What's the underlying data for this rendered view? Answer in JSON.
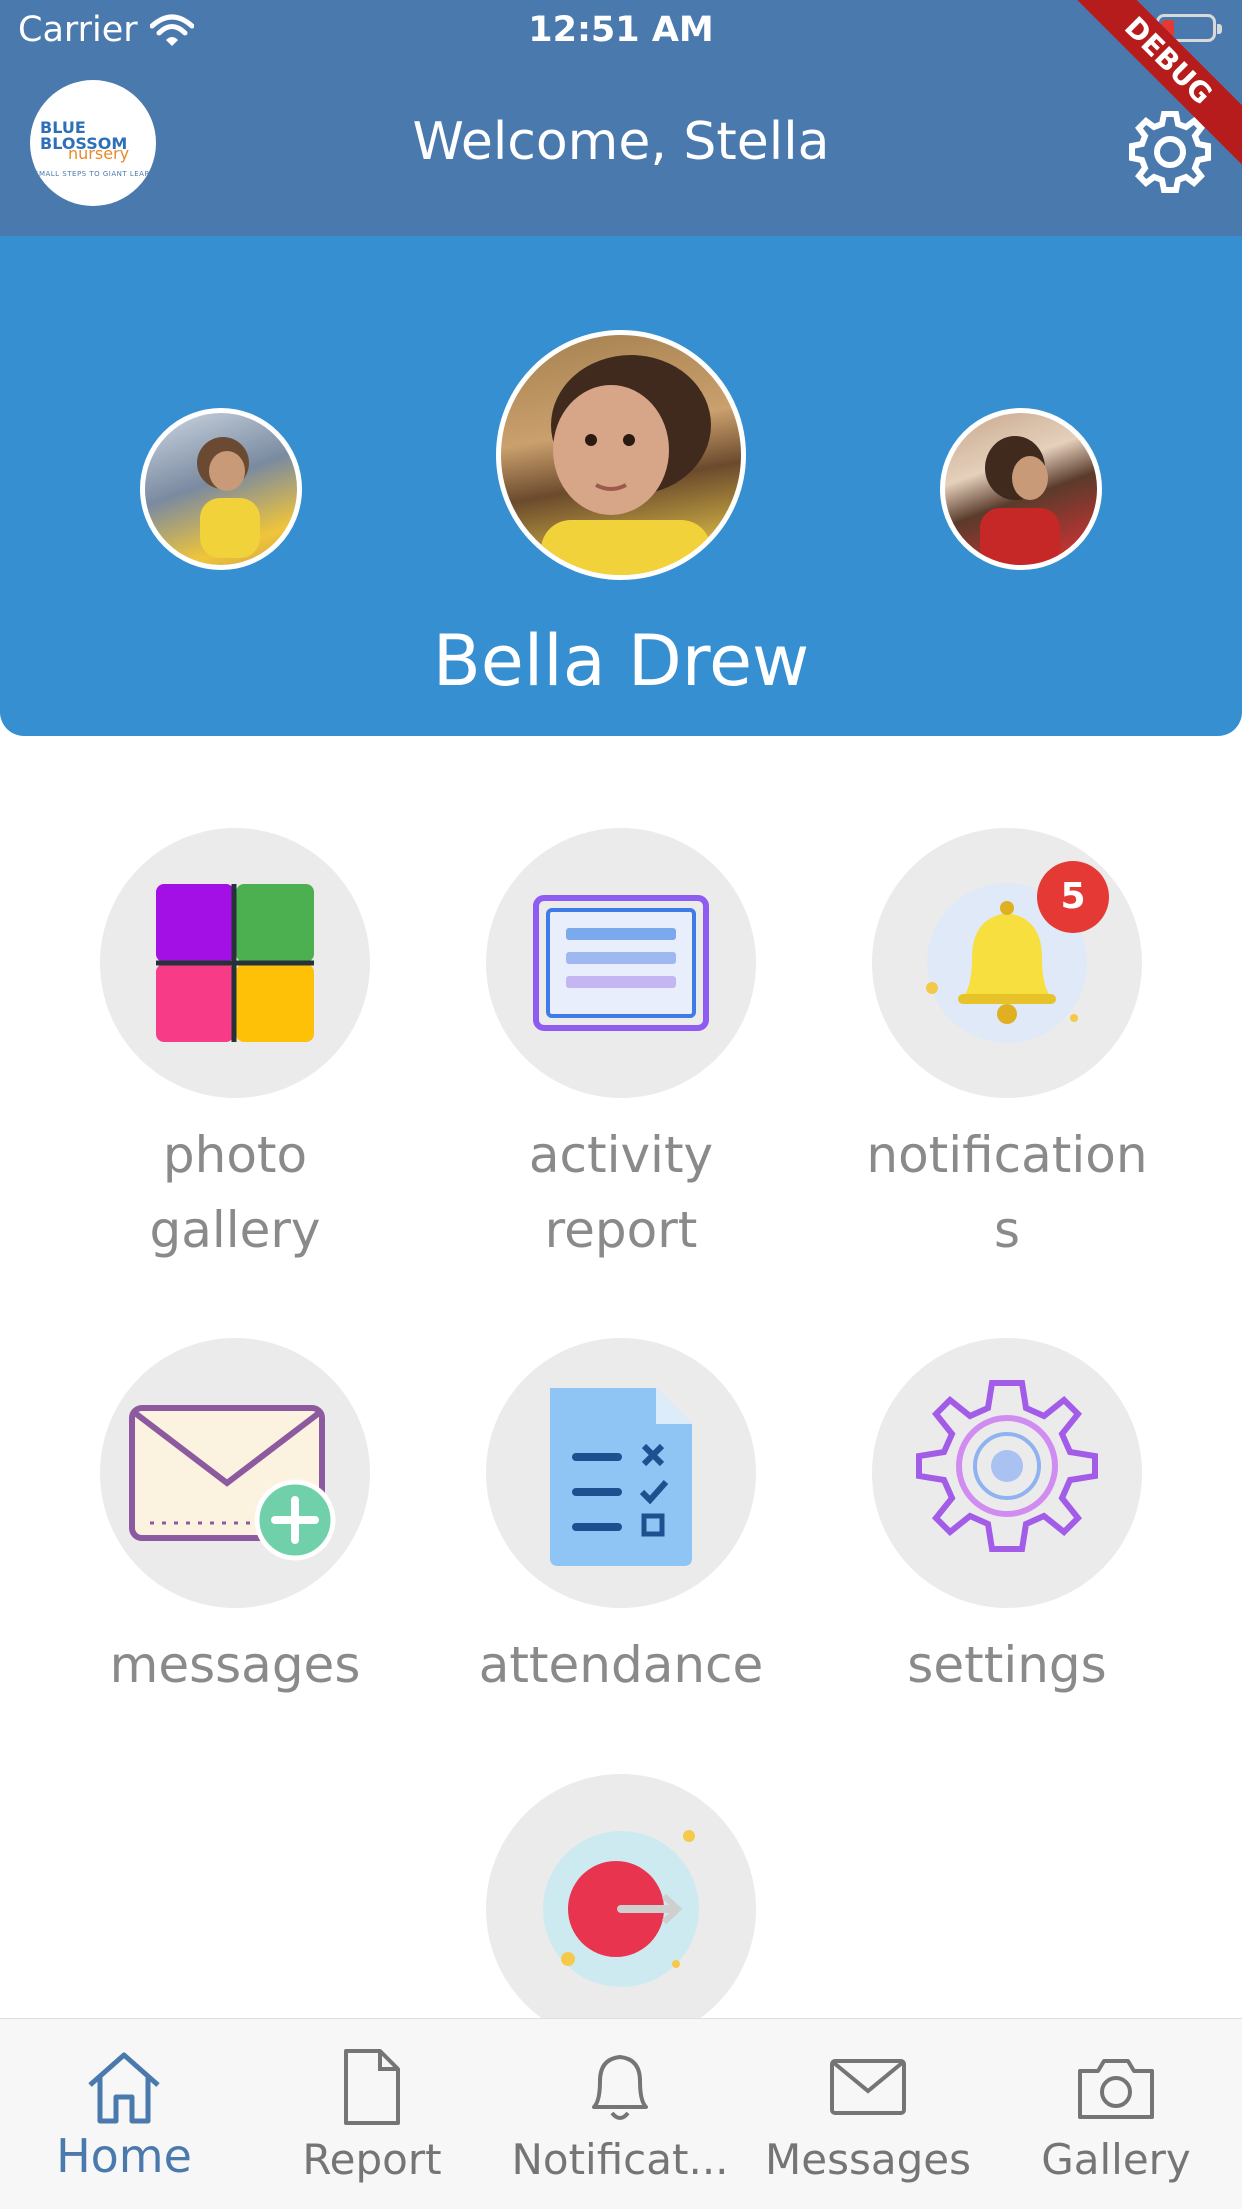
{
  "status_bar": {
    "carrier": "Carrier",
    "time": "12:51 AM"
  },
  "header": {
    "title": "Welcome, Stella",
    "logo": {
      "line1": "BLUE BLOSSOM",
      "line2": "nursery",
      "line3": "SMALL STEPS TO GIANT LEAPS"
    },
    "debug_banner": "DEBUG"
  },
  "hero": {
    "child_name": "Bella Drew"
  },
  "menu": {
    "items": [
      {
        "label": "photo gallery",
        "icon": "photo-gallery-icon"
      },
      {
        "label": "activity report",
        "icon": "activity-report-icon"
      },
      {
        "label": "notification s",
        "icon": "bell-icon",
        "badge": "5"
      },
      {
        "label": "messages",
        "icon": "envelope-add-icon"
      },
      {
        "label": "attendance",
        "icon": "checklist-document-icon"
      },
      {
        "label": "settings",
        "icon": "gear-icon"
      },
      {
        "label": "",
        "icon": "logout-icon"
      }
    ],
    "labels": {
      "photo_gallery_1": "photo",
      "photo_gallery_2": "gallery",
      "activity_report_1": "activity",
      "activity_report_2": "report",
      "notifications_1": "notification",
      "notifications_2": "s",
      "messages": "messages",
      "attendance": "attendance",
      "settings": "settings"
    }
  },
  "bottom_nav": {
    "items": [
      {
        "label": "Home",
        "icon": "home-icon",
        "active": true
      },
      {
        "label": "Report",
        "icon": "document-icon"
      },
      {
        "label": "Notificat...",
        "icon": "bell-outline-icon"
      },
      {
        "label": "Messages",
        "icon": "mail-icon"
      },
      {
        "label": "Gallery",
        "icon": "camera-icon"
      }
    ]
  },
  "colors": {
    "header": "#4a7aad",
    "hero": "#368fd0",
    "badge": "#e53935",
    "label_gray": "#8a8a8a",
    "nav_active": "#4a7aad"
  }
}
